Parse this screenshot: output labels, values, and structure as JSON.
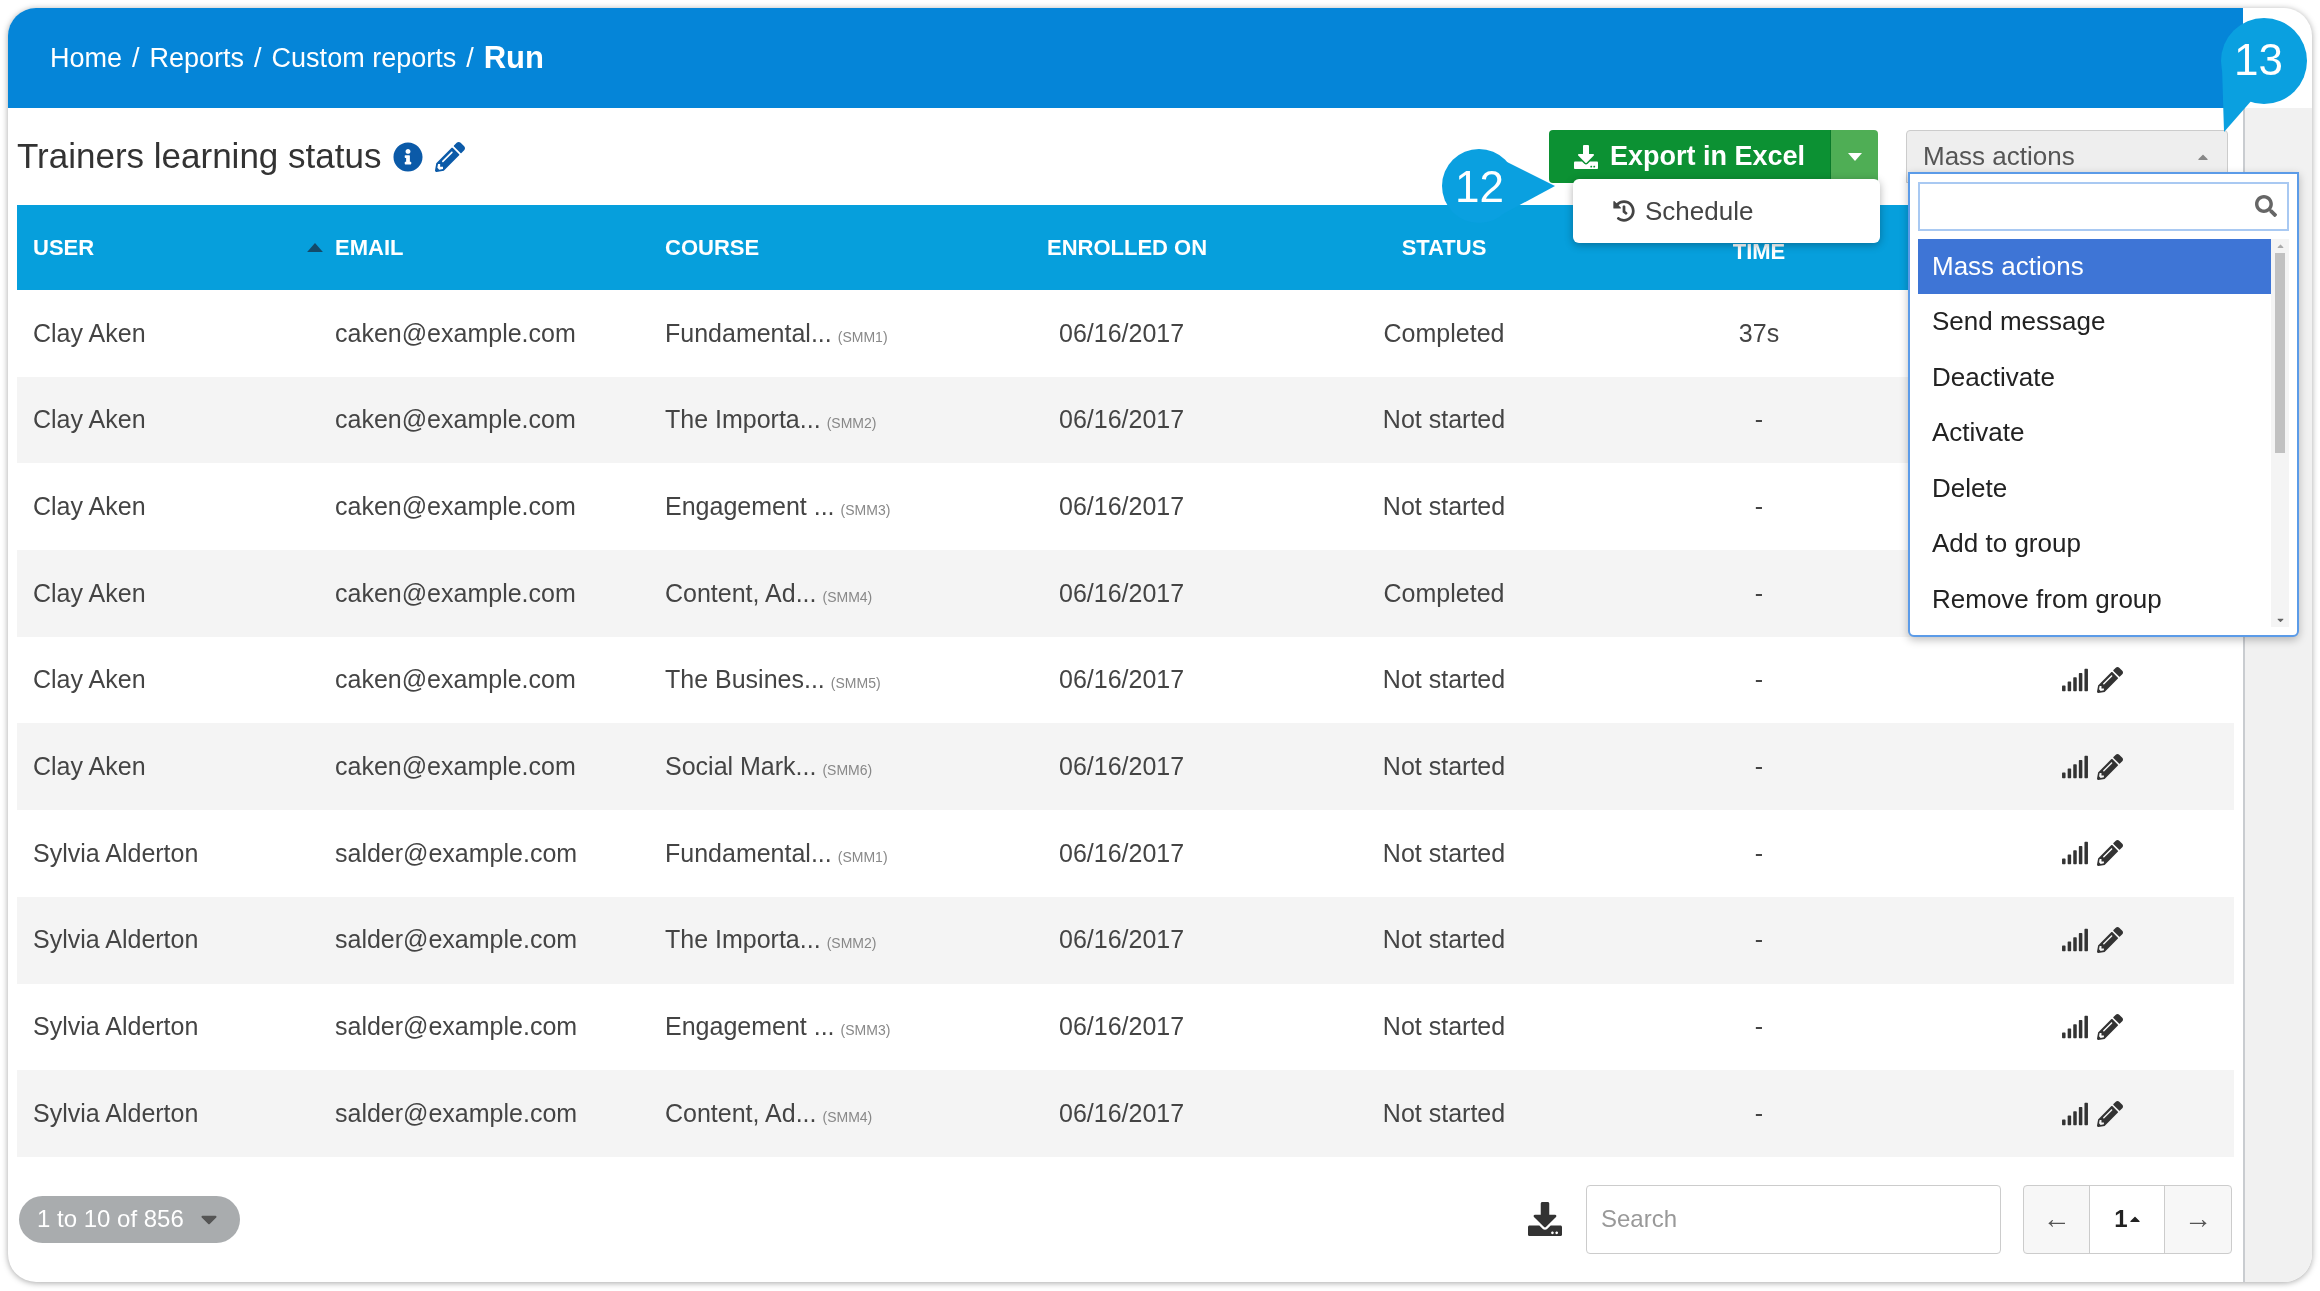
{
  "breadcrumb": [
    {
      "label": "Home",
      "current": false
    },
    {
      "label": "Reports",
      "current": false
    },
    {
      "label": "Custom reports",
      "current": false
    },
    {
      "label": "Run",
      "current": true
    }
  ],
  "breadcrumb_separator": "/",
  "title": "Trainers learning status",
  "export": {
    "label": "Export in Excel",
    "open": true,
    "menu": [
      {
        "label": "Schedule"
      }
    ]
  },
  "mass_actions": {
    "label": "Mass actions",
    "expanded": true,
    "options": [
      {
        "label": "Mass actions",
        "selected": true
      },
      {
        "label": "Send message",
        "selected": false
      },
      {
        "label": "Deactivate",
        "selected": false
      },
      {
        "label": "Activate",
        "selected": false
      },
      {
        "label": "Delete",
        "selected": false
      },
      {
        "label": "Add to group",
        "selected": false
      },
      {
        "label": "Remove from group",
        "selected": false
      }
    ]
  },
  "table": {
    "columns": [
      {
        "label": "USER",
        "sorted": true
      },
      {
        "label": "EMAIL",
        "sorted": false
      },
      {
        "label": "COURSE",
        "sorted": false
      },
      {
        "label": "ENROLLED ON",
        "sorted": false
      },
      {
        "label": "STATUS",
        "sorted": false
      },
      {
        "label": "TIME",
        "sorted": false
      }
    ],
    "rows": [
      {
        "user": "Clay Aken",
        "email": "caken@example.com",
        "course": "Fundamental...",
        "course_code": "(SMM1)",
        "enrolled_on": "06/16/2017",
        "status": "Completed",
        "time": "37s"
      },
      {
        "user": "Clay Aken",
        "email": "caken@example.com",
        "course": "The Importa...",
        "course_code": "(SMM2)",
        "enrolled_on": "06/16/2017",
        "status": "Not started",
        "time": "-"
      },
      {
        "user": "Clay Aken",
        "email": "caken@example.com",
        "course": "Engagement ...",
        "course_code": "(SMM3)",
        "enrolled_on": "06/16/2017",
        "status": "Not started",
        "time": "-"
      },
      {
        "user": "Clay Aken",
        "email": "caken@example.com",
        "course": "Content, Ad...",
        "course_code": "(SMM4)",
        "enrolled_on": "06/16/2017",
        "status": "Completed",
        "time": "-"
      },
      {
        "user": "Clay Aken",
        "email": "caken@example.com",
        "course": "The Busines...",
        "course_code": "(SMM5)",
        "enrolled_on": "06/16/2017",
        "status": "Not started",
        "time": "-"
      },
      {
        "user": "Clay Aken",
        "email": "caken@example.com",
        "course": "Social Mark...",
        "course_code": "(SMM6)",
        "enrolled_on": "06/16/2017",
        "status": "Not started",
        "time": "-"
      },
      {
        "user": "Sylvia Alderton",
        "email": "salder@example.com",
        "course": "Fundamental...",
        "course_code": "(SMM1)",
        "enrolled_on": "06/16/2017",
        "status": "Not started",
        "time": "-"
      },
      {
        "user": "Sylvia Alderton",
        "email": "salder@example.com",
        "course": "The Importa...",
        "course_code": "(SMM2)",
        "enrolled_on": "06/16/2017",
        "status": "Not started",
        "time": "-"
      },
      {
        "user": "Sylvia Alderton",
        "email": "salder@example.com",
        "course": "Engagement ...",
        "course_code": "(SMM3)",
        "enrolled_on": "06/16/2017",
        "status": "Not started",
        "time": "-"
      },
      {
        "user": "Sylvia Alderton",
        "email": "salder@example.com",
        "course": "Content, Ad...",
        "course_code": "(SMM4)",
        "enrolled_on": "06/16/2017",
        "status": "Not started",
        "time": "-"
      }
    ]
  },
  "footer": {
    "range": "1 to 10 of 856",
    "search_placeholder": "Search",
    "prev": "←",
    "page": "1",
    "next": "→"
  },
  "callouts": [
    {
      "number": "12"
    },
    {
      "number": "13"
    }
  ]
}
